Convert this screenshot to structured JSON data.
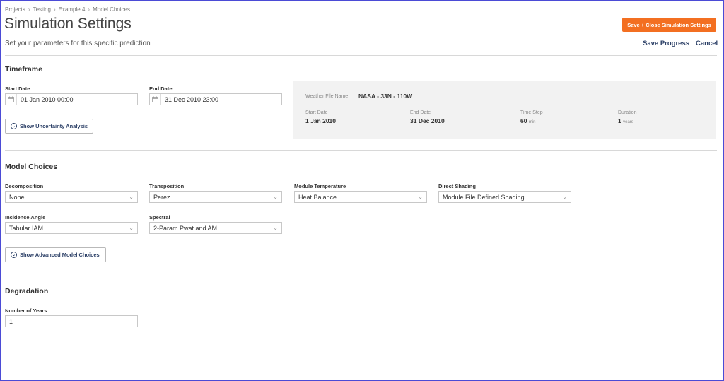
{
  "breadcrumb": [
    "Projects",
    "Testing",
    "Example 4",
    "Model Choices"
  ],
  "page": {
    "title": "Simulation Settings",
    "subtitle": "Set your parameters for this specific prediction"
  },
  "actions": {
    "save_close": "Save + Close Simulation Settings",
    "save_progress": "Save Progress",
    "cancel": "Cancel"
  },
  "timeframe": {
    "title": "Timeframe",
    "start_label": "Start Date",
    "start_value": "01 Jan 2010 00:00",
    "end_label": "End Date",
    "end_value": "31 Dec 2010 23:00",
    "uncertainty_button": "Show Uncertainty Analysis",
    "weather": {
      "file_label": "Weather File Name",
      "file_value": "NASA - 33N - 110W",
      "start_label": "Start Date",
      "start_value": "1 Jan 2010",
      "end_label": "End Date",
      "end_value": "31 Dec 2010",
      "step_label": "Time Step",
      "step_value": "60",
      "step_unit": "min",
      "duration_label": "Duration",
      "duration_value": "1",
      "duration_unit": "years"
    }
  },
  "model": {
    "title": "Model Choices",
    "fields": [
      {
        "label": "Decomposition",
        "value": "None"
      },
      {
        "label": "Transposition",
        "value": "Perez"
      },
      {
        "label": "Module Temperature",
        "value": "Heat Balance"
      },
      {
        "label": "Direct Shading",
        "value": "Module File Defined Shading"
      },
      {
        "label": "Incidence Angle",
        "value": "Tabular IAM"
      },
      {
        "label": "Spectral",
        "value": "2-Param Pwat and AM"
      }
    ],
    "advanced_button": "Show Advanced Model Choices"
  },
  "degradation": {
    "title": "Degradation",
    "years_label": "Number of Years",
    "years_value": "1"
  },
  "colors": {
    "accent": "#f36f21",
    "link": "#2b3f66",
    "frame": "#4b4bd6"
  }
}
